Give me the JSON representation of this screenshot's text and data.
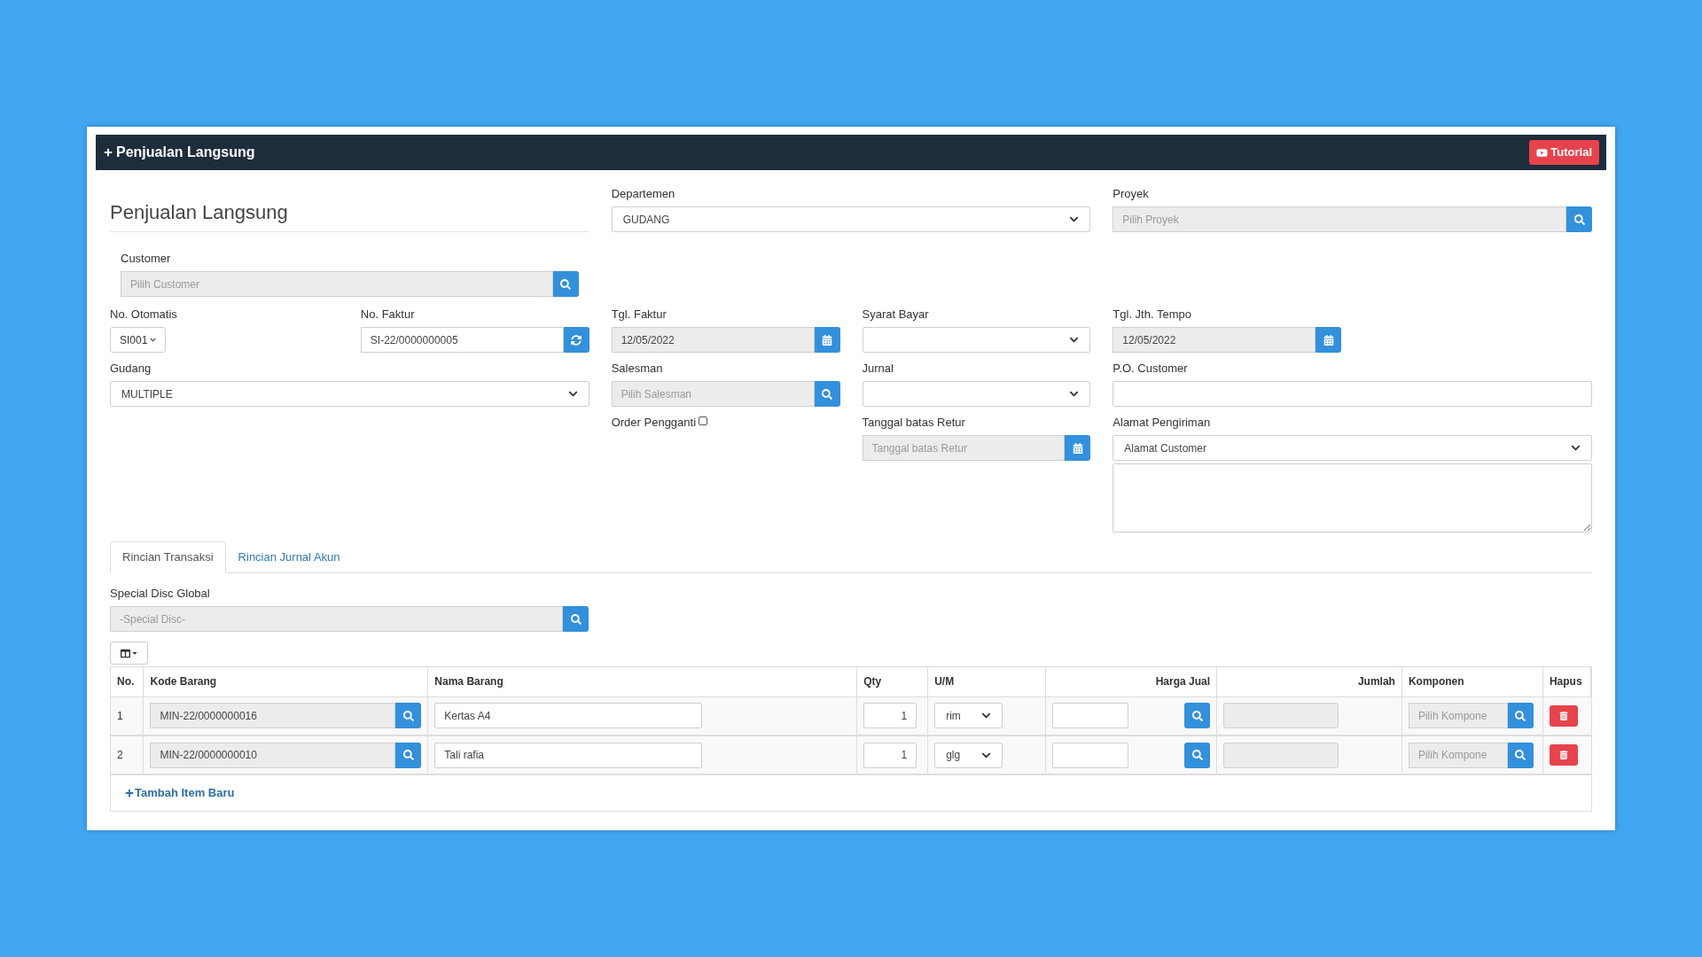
{
  "header": {
    "title": "Penjualan Langsung",
    "tutorial_button": "Tutorial"
  },
  "form_title": "Penjualan Langsung",
  "departemen": {
    "label": "Departemen",
    "value": "GUDANG"
  },
  "proyek": {
    "label": "Proyek",
    "placeholder": "Pilih Proyek"
  },
  "customer": {
    "label": "Customer",
    "placeholder": "Pilih Customer"
  },
  "no_otomatis": {
    "label": "No. Otomatis",
    "value": "SI001"
  },
  "no_faktur": {
    "label": "No. Faktur",
    "value": "SI-22/0000000005"
  },
  "tgl_faktur": {
    "label": "Tgl. Faktur",
    "value": "12/05/2022"
  },
  "syarat_bayar": {
    "label": "Syarat Bayar"
  },
  "tgl_jth_tempo": {
    "label": "Tgl. Jth. Tempo",
    "value": "12/05/2022"
  },
  "gudang": {
    "label": "Gudang",
    "value": "MULTIPLE"
  },
  "salesman": {
    "label": "Salesman",
    "placeholder": "Pilih Salesman"
  },
  "jurnal": {
    "label": "Jurnal"
  },
  "po_customer": {
    "label": "P.O. Customer"
  },
  "order_pengganti": {
    "label": "Order Pengganti",
    "checked": false
  },
  "tanggal_batas_retur": {
    "label": "Tanggal batas Retur",
    "placeholder": "Tanggal batas Retur"
  },
  "alamat_pengiriman": {
    "label": "Alamat Pengiriman",
    "value": "Alamat Customer"
  },
  "tabs": [
    {
      "label": "Rincian Transaksi",
      "selected": true
    },
    {
      "label": "Rincian Jurnal Akun",
      "selected": false
    }
  ],
  "special_disc": {
    "label": "Special Disc Global",
    "placeholder": "-Special Disc-"
  },
  "table": {
    "columns": [
      "No.",
      "Kode Barang",
      "Nama Barang",
      "Qty",
      "U/M",
      "Harga Jual",
      "Jumlah",
      "Komponen",
      "Hapus"
    ],
    "rows": [
      {
        "no": "1",
        "kode_barang": "MIN-22/0000000016",
        "nama_barang": "Kertas A4",
        "qty": "1",
        "um": "rim",
        "komponen_placeholder": "Pilih Kompone"
      },
      {
        "no": "2",
        "kode_barang": "MIN-22/0000000010",
        "nama_barang": "Tali rafia",
        "qty": "1",
        "um": "glg",
        "komponen_placeholder": "Pilih Kompone"
      }
    ]
  },
  "add_item": "Tambah Item Baru"
}
